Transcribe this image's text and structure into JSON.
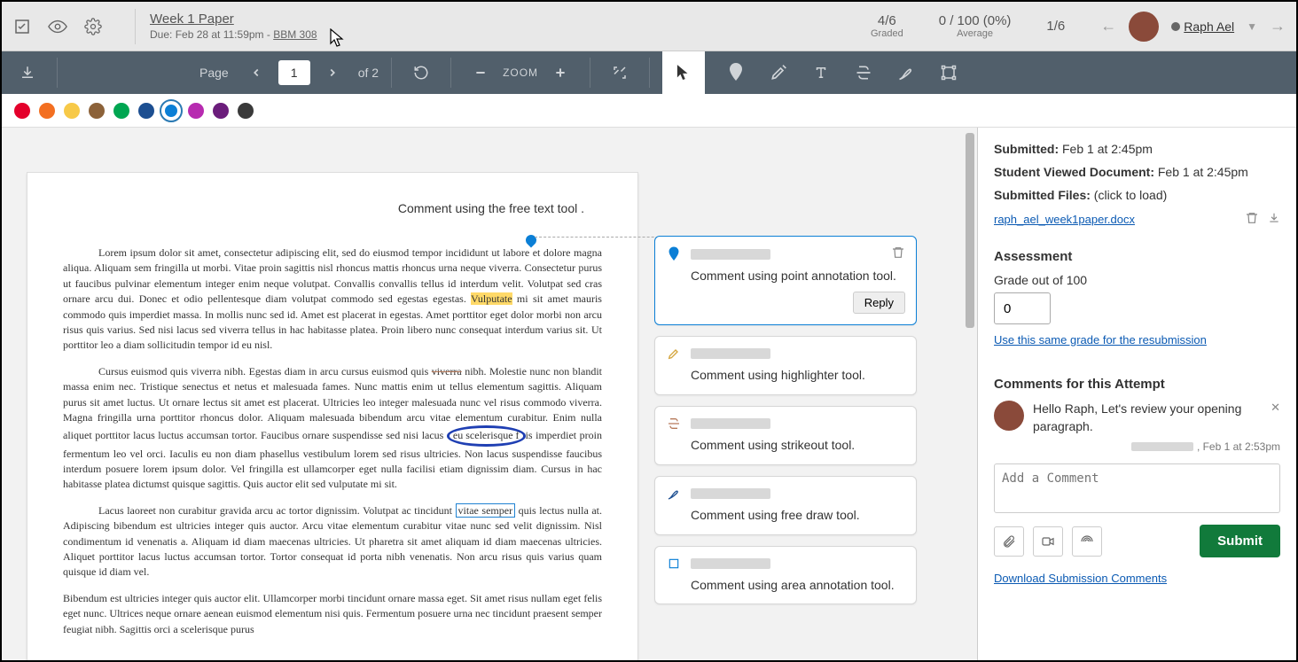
{
  "header": {
    "title": "Week 1 Paper",
    "due_prefix": "Due: ",
    "due_date": "Feb 28 at 11:59pm",
    "course_code": "BBM 308",
    "stats": {
      "graded": {
        "value": "4/6",
        "label": "Graded"
      },
      "average": {
        "value": "0 / 100 (0%)",
        "label": "Average"
      },
      "count": {
        "value": "1/6",
        "label": ""
      }
    },
    "student_name": "Raph Ael"
  },
  "toolbar": {
    "page_label": "Page",
    "page_current": "1",
    "page_total": "of 2",
    "zoom_label": "ZOOM"
  },
  "colors": [
    "#e4002b",
    "#f36f21",
    "#f7c948",
    "#8c6239",
    "#00a651",
    "#1d4f91",
    "#0b7fd6",
    "#b72bb0",
    "#6b1d7b",
    "#3a3a3a"
  ],
  "document": {
    "free_text": "Comment using the free text tool .",
    "p1_a": "Lorem ipsum dolor sit amet, consectetur adipiscing elit, sed do eiusmod tempor incididunt ut labore et dolore magna aliqua. Aliquam sem fringilla ut morbi. Vitae proin sagittis nisl rhoncus mattis rhoncus urna neque viverra. Consectetur purus ut faucibus pulvinar elementum integer enim neque volutpat. Convallis convallis tellus id interdum velit. Volutpat sed cras ornare arcu dui. Donec et odio pellentesque diam volutpat commodo sed egestas egestas. ",
    "p1_hl": "Vulputate",
    "p1_b": " mi sit amet mauris commodo quis imperdiet massa. In mollis nunc sed id. Amet est placerat in egestas. Amet porttitor eget dolor morbi non arcu risus quis varius. Sed nisi lacus sed viverra tellus in hac habitasse platea. Proin libero nunc consequat interdum varius sit. Ut porttitor leo a diam sollicitudin tempor id eu nisl.",
    "p2_a": "Cursus euismod quis viverra nibh. Egestas diam in arcu cursus euismod quis ",
    "p2_strike": "viverra",
    "p2_b": " nibh. Molestie nunc non blandit massa enim nec. Tristique senectus et netus et malesuada fames. Nunc mattis enim ut tellus elementum sagittis. Aliquam purus sit amet luctus. Ut ornare lectus sit amet est placerat. Ultricies leo integer malesuada nunc vel risus commodo viverra. Magna fringilla urna porttitor rhoncus dolor. Aliquam malesuada bibendum arcu vitae elementum curabitur. Enim nulla aliquet porttitor lacus luctus accumsan tortor. Faucibus ornare suspendisse sed nisi lacus ",
    "p2_ellipse": "eu scelerisque f",
    "p2_c": "is imperdiet proin fermentum leo vel orci. Iaculis eu non diam phasellus vestibulum lorem sed risus ultricies. Non lacus suspendisse faucibus interdum posuere lorem ipsum dolor. Vel fringilla est ullamcorper eget nulla facilisi etiam dignissim diam. Cursus in hac habitasse platea dictumst quisque sagittis. Quis auctor elit sed vulputate mi sit.",
    "p3_a": "Lacus laoreet non curabitur gravida arcu ac tortor dignissim. Volutpat ac tincidunt ",
    "p3_box": "vitae semper",
    "p3_b": " quis lectus nulla at. Adipiscing bibendum est ultricies integer quis auctor. Arcu vitae elementum curabitur vitae nunc sed velit dignissim. Nisl condimentum id venenatis a. Aliquam id diam maecenas ultricies. Ut pharetra sit amet aliquam id diam maecenas ultricies. Aliquet porttitor lacus luctus accumsan tortor. Tortor consequat id porta nibh venenatis. Non arcu risus quis varius quam quisque id diam vel.",
    "p4": "Bibendum est ultricies integer quis auctor elit. Ullamcorper morbi tincidunt ornare massa eget. Sit amet risus nullam eget felis eget nunc. Ultrices neque ornare aenean euismod elementum nisi quis. Fermentum posuere urna nec tincidunt praesent semper feugiat nibh. Sagittis orci a scelerisque purus"
  },
  "cards": [
    {
      "text": "Comment using point annotation tool.",
      "active": true,
      "reply": "Reply"
    },
    {
      "text": "Comment using highlighter tool."
    },
    {
      "text": "Comment using strikeout tool."
    },
    {
      "text": "Comment using free draw tool."
    },
    {
      "text": "Comment using area annotation tool."
    }
  ],
  "sidebar": {
    "submitted_label": "Submitted:",
    "submitted_val": "Feb 1 at 2:45pm",
    "viewed_label": "Student Viewed Document:",
    "viewed_val": "Feb 1 at 2:45pm",
    "files_label": "Submitted Files:",
    "files_hint": "(click to load)",
    "file_name": "raph_ael_week1paper.docx",
    "assessment_title": "Assessment",
    "grade_label": "Grade out of 100",
    "grade_value": "0",
    "same_grade_link": "Use this same grade for the resubmission",
    "comments_title": "Comments for this Attempt",
    "comment_text": "Hello Raph, Let's review your opening paragraph.",
    "comment_date": ", Feb 1 at 2:53pm",
    "add_comment_placeholder": "Add a Comment",
    "submit_label": "Submit",
    "download_link": "Download Submission Comments"
  }
}
